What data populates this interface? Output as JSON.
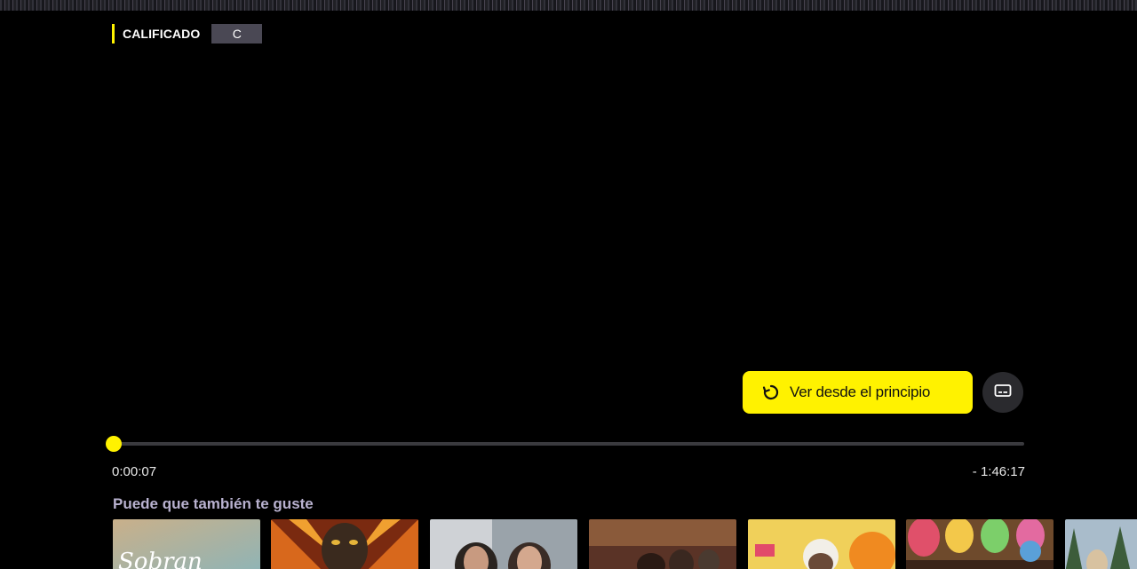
{
  "header": {
    "title": "",
    "channel_logo_text": ""
  },
  "rating": {
    "label": "CALIFICADO",
    "value": "C"
  },
  "controls": {
    "restart_label": "Ver desde el principio",
    "restart_icon": "restart-icon",
    "subtitles_icon": "subtitles-icon",
    "elapsed": "0:00:07",
    "remaining": "- 1:46:17",
    "progress_fraction": 0.001
  },
  "recommendations": {
    "title": "Puede que también te guste",
    "items": [
      {
        "overlay_text": "Sobran"
      },
      {
        "overlay_text": ""
      },
      {
        "overlay_text": ""
      },
      {
        "overlay_text": ""
      },
      {
        "overlay_text": ""
      },
      {
        "overlay_text": ""
      },
      {
        "overlay_text": ""
      }
    ]
  },
  "colors": {
    "accent": "#fff200",
    "background": "#000000",
    "badge": "#4a4854",
    "section_title": "#b9b2d0"
  }
}
